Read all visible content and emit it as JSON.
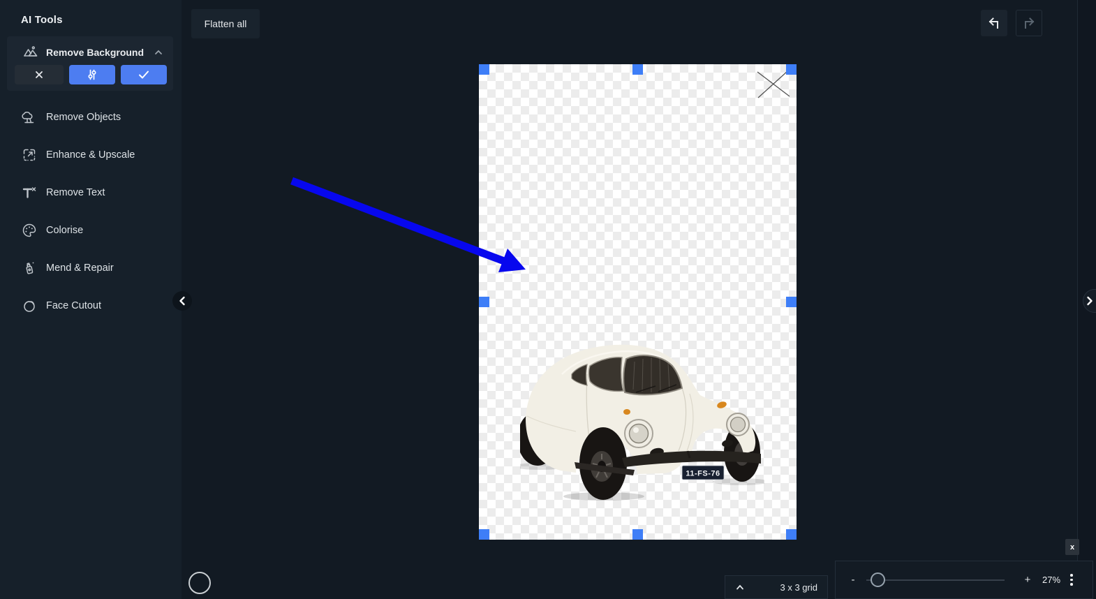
{
  "sidebar": {
    "title": "AI Tools",
    "active_tool": {
      "label": "Remove Background",
      "icon": "image-mountains-icon"
    },
    "items": [
      {
        "label": "Remove Objects",
        "icon": "tree-icon"
      },
      {
        "label": "Enhance & Upscale",
        "icon": "expand-icon"
      },
      {
        "label": "Remove Text",
        "icon": "text-remove-icon"
      },
      {
        "label": "Colorise",
        "icon": "palette-icon"
      },
      {
        "label": "Mend & Repair",
        "icon": "glue-bottle-icon"
      },
      {
        "label": "Face Cutout",
        "icon": "face-icon"
      }
    ]
  },
  "topbar": {
    "flatten_label": "Flatten all"
  },
  "canvas": {
    "car": {
      "plate": "11-FS-76"
    },
    "selection_handle_color": "#3e7ef7",
    "annotation_arrow_color": "#0707ee"
  },
  "bottombar": {
    "grid_label": "3 x 3 grid",
    "zoom_value": "27%",
    "zoom_out_symbol": "-",
    "zoom_in_symbol": "+"
  },
  "overlay": {
    "panel_close_label": "x"
  },
  "colors": {
    "accent_blue": "#4d7df1",
    "sidebar_bg": "#16202a",
    "main_bg": "#121a23"
  }
}
